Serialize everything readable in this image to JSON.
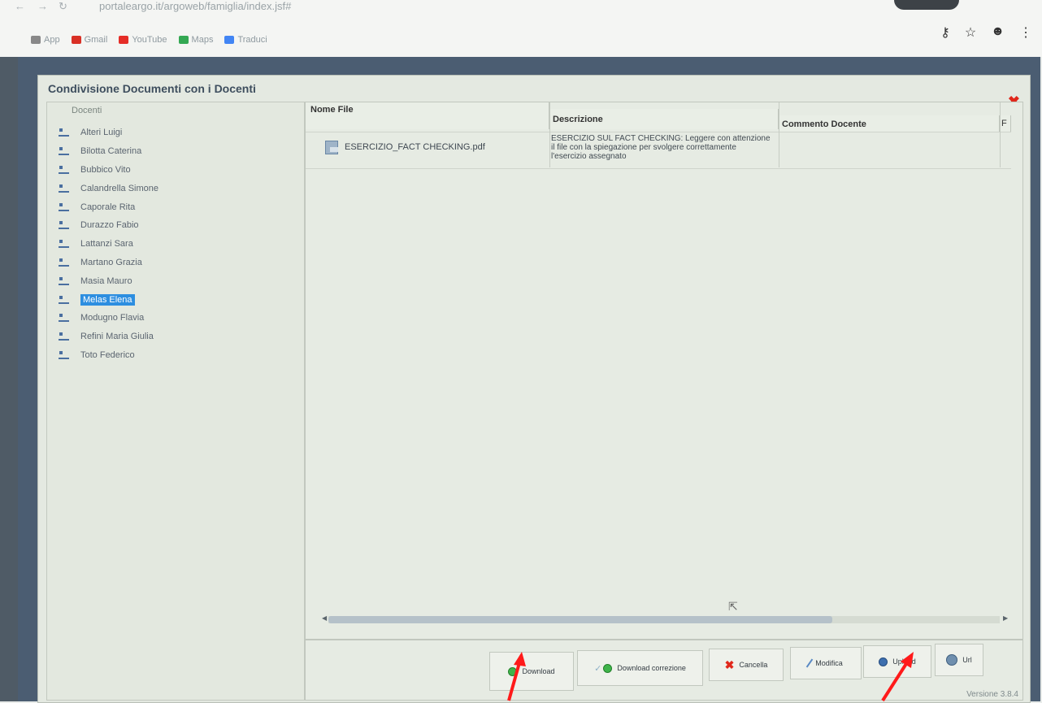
{
  "browser": {
    "url": "portaleargo.it/argoweb/famiglia/index.jsf#",
    "bookmarks": [
      {
        "label": "App",
        "color": "#888888"
      },
      {
        "label": "Gmail",
        "color": "#d93025"
      },
      {
        "label": "YouTube",
        "color": "#e52d27"
      },
      {
        "label": "Maps",
        "color": "#34a853"
      },
      {
        "label": "Traduci",
        "color": "#4285f4"
      }
    ],
    "right_icons": [
      "key-icon",
      "star-icon",
      "account-icon",
      "more-icon"
    ]
  },
  "dialog": {
    "title": "Condivisione Documenti con i Docenti",
    "close_color": "#e0281b"
  },
  "tree": {
    "root_label": "Docenti",
    "items": [
      {
        "label": "Alteri Luigi"
      },
      {
        "label": "Bilotta Caterina"
      },
      {
        "label": "Bubbico Vito"
      },
      {
        "label": "Calandrella Simone"
      },
      {
        "label": "Caporale Rita"
      },
      {
        "label": "Durazzo Fabio"
      },
      {
        "label": "Lattanzi Sara"
      },
      {
        "label": "Martano Grazia"
      },
      {
        "label": "Masia Mauro"
      },
      {
        "label": "Melas Elena",
        "selected": true
      },
      {
        "label": "Modugno Flavia"
      },
      {
        "label": "Refini Maria Giulia"
      },
      {
        "label": "Toto Federico"
      }
    ],
    "selected_color": "#2d8ee0"
  },
  "table": {
    "headers": {
      "name": "Nome File",
      "description": "Descrizione",
      "comment": "Commento Docente",
      "extra": "F"
    },
    "rows": [
      {
        "name": "ESERCIZIO_FACT CHECKING.pdf",
        "description": "ESERCIZIO SUL FACT CHECKING: Leggere con attenzione il file con la spiegazione per svolgere correttamente l'esercizio assegnato",
        "comment": ""
      }
    ]
  },
  "buttons": {
    "download": "Download",
    "download_correction": "Download correzione",
    "cancel": "Cancella",
    "edit": "Modifica",
    "upload": "Upload",
    "url": "Url"
  },
  "version": "Versione 3.8.4",
  "annotation_color": "#ff1a1a"
}
